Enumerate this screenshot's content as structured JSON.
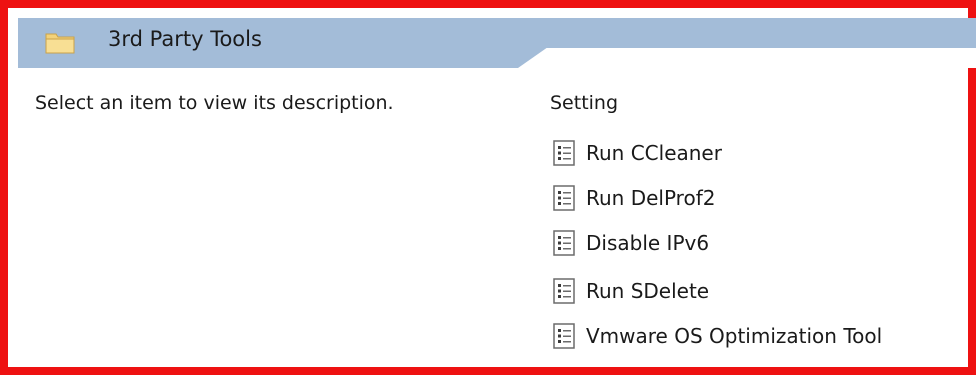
{
  "header": {
    "title": "3rd Party Tools",
    "icon": "folder-icon"
  },
  "description_pane": {
    "text": "Select an item to view its description."
  },
  "settings_list": {
    "column_header": "Setting",
    "items": [
      {
        "label": "Run CCleaner",
        "icon": "policy-setting-icon"
      },
      {
        "label": "Run DelProf2",
        "icon": "policy-setting-icon"
      },
      {
        "label": "Disable IPv6",
        "icon": "policy-setting-icon"
      },
      {
        "label": "Run SDelete",
        "icon": "policy-setting-icon"
      },
      {
        "label": "Vmware OS Optimization Tool",
        "icon": "policy-setting-icon"
      }
    ]
  },
  "colors": {
    "highlight_border": "#ee1111",
    "header_background": "#a3bcd8"
  }
}
